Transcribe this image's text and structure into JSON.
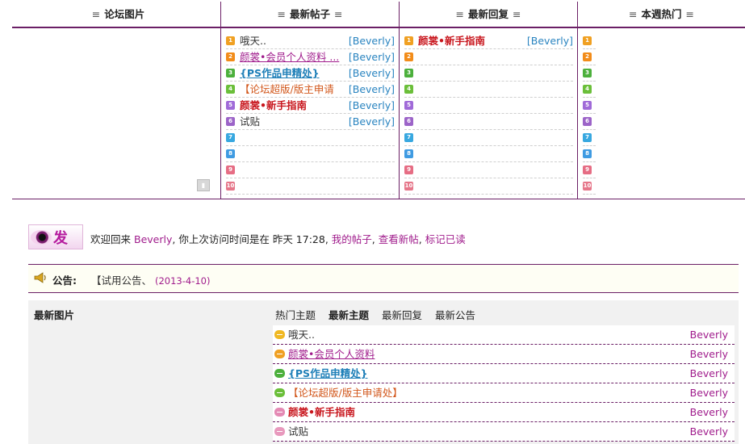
{
  "board": {
    "headers": [
      "论坛图片",
      "最新帖子",
      "最新回复",
      "本週热门"
    ],
    "header_marker": "≡",
    "latest_posts": [
      {
        "num": "1",
        "title": "哦天..",
        "author": "[Beverly]",
        "style": "plain"
      },
      {
        "num": "2",
        "title": "颜裳•会员个人资料 ...",
        "author": "[Beverly]",
        "style": "purple"
      },
      {
        "num": "3",
        "title": "{PS作品申精处}",
        "author": "[Beverly]",
        "style": "blue"
      },
      {
        "num": "4",
        "title": "【论坛超版/版主申请",
        "author": "[Beverly]",
        "style": "orange"
      },
      {
        "num": "5",
        "title": "颜裳•新手指南",
        "author": "[Beverly]",
        "style": "red"
      },
      {
        "num": "6",
        "title": "试贴",
        "author": "[Beverly]",
        "style": "plain"
      },
      {
        "num": "7",
        "title": "",
        "author": "",
        "style": "plain"
      },
      {
        "num": "8",
        "title": "",
        "author": "",
        "style": "plain"
      },
      {
        "num": "9",
        "title": "",
        "author": "",
        "style": "plain"
      },
      {
        "num": "10",
        "title": "",
        "author": "",
        "style": "plain"
      }
    ],
    "latest_replies": [
      {
        "num": "1",
        "title": "颜裳•新手指南",
        "author": "[Beverly]",
        "style": "red"
      },
      {
        "num": "2",
        "title": "",
        "author": "",
        "style": "plain"
      },
      {
        "num": "3",
        "title": "",
        "author": "",
        "style": "plain"
      },
      {
        "num": "4",
        "title": "",
        "author": "",
        "style": "plain"
      },
      {
        "num": "5",
        "title": "",
        "author": "",
        "style": "plain"
      },
      {
        "num": "6",
        "title": "",
        "author": "",
        "style": "plain"
      },
      {
        "num": "7",
        "title": "",
        "author": "",
        "style": "plain"
      },
      {
        "num": "8",
        "title": "",
        "author": "",
        "style": "plain"
      },
      {
        "num": "9",
        "title": "",
        "author": "",
        "style": "plain"
      },
      {
        "num": "10",
        "title": "",
        "author": "",
        "style": "plain"
      }
    ],
    "weekly_hot": [
      {
        "num": "1"
      },
      {
        "num": "2"
      },
      {
        "num": "3"
      },
      {
        "num": "4"
      },
      {
        "num": "5"
      },
      {
        "num": "6"
      },
      {
        "num": "7"
      },
      {
        "num": "8"
      },
      {
        "num": "9"
      },
      {
        "num": "10"
      }
    ]
  },
  "post_button": {
    "label": "发帖"
  },
  "welcome": {
    "prefix": "欢迎回来",
    "username": "Beverly",
    "middle": ", 你上次访问时间是在",
    "last_visit": "昨天 17:28",
    "links": [
      "我的帖子",
      "查看新帖",
      "标记已读"
    ]
  },
  "notice": {
    "label": "公告:",
    "text": "【试用公告、",
    "date": "(2013-4-10)"
  },
  "images_panel": {
    "title": "最新图片"
  },
  "topics_panel": {
    "tabs": [
      {
        "label": "热门主题",
        "active": false
      },
      {
        "label": "最新主题",
        "active": true
      },
      {
        "label": "最新回复",
        "active": false
      },
      {
        "label": "最新公告",
        "active": false
      }
    ],
    "items": [
      {
        "title": "哦天..",
        "author": "Beverly",
        "style": "plain"
      },
      {
        "title": "颜裳•会员个人资料",
        "author": "Beverly",
        "style": "purple"
      },
      {
        "title": "{PS作品申精处}",
        "author": "Beverly",
        "style": "blue"
      },
      {
        "title": "【论坛超版/版主申请处】",
        "author": "Beverly",
        "style": "orange"
      },
      {
        "title": "颜裳•新手指南",
        "author": "Beverly",
        "style": "red"
      },
      {
        "title": "试贴",
        "author": "Beverly",
        "style": "plain"
      }
    ]
  },
  "colors": {
    "accent_purple": "#6b1f66",
    "link_purple": "#a01c8c",
    "author_blue": "#2a84c0"
  }
}
